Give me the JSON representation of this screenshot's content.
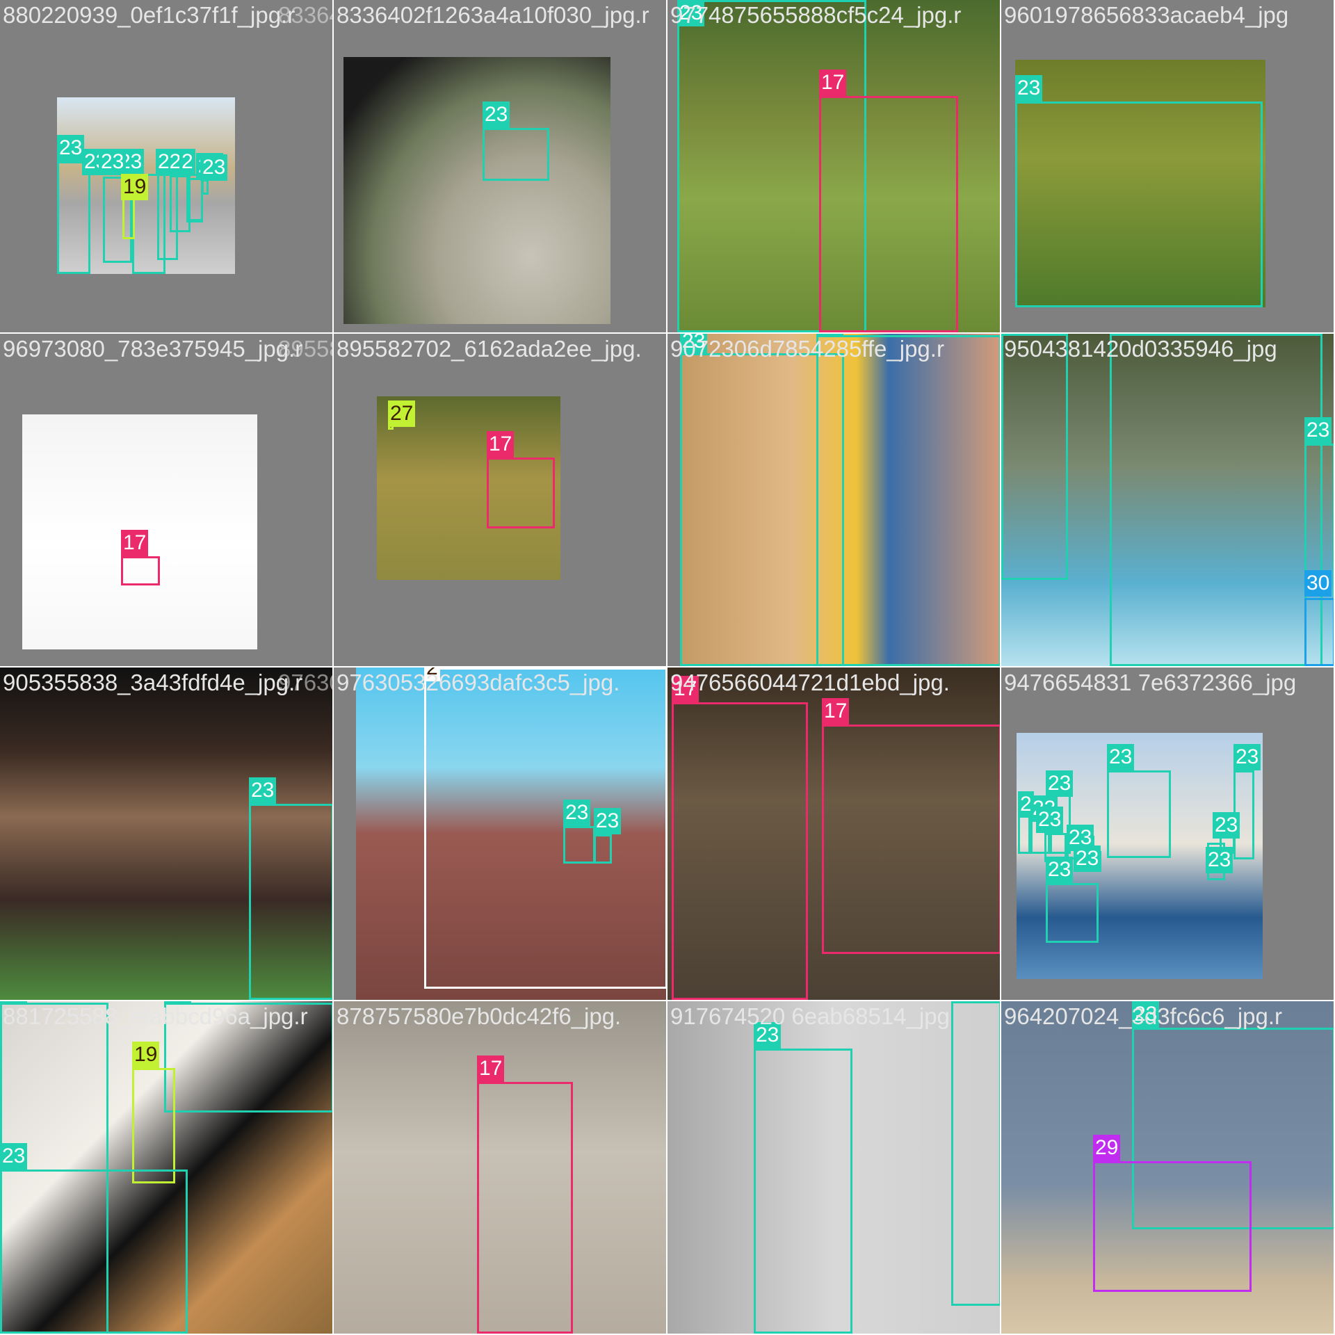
{
  "colors": {
    "23": "#1fd1b0",
    "17": "#ea2a6b",
    "19": "#c2f032",
    "27": "#c2f032",
    "29": "#c02cf0",
    "30": "#1ca1e8",
    "2": "#ffffff"
  },
  "tiles": [
    {
      "names": [
        "880220939_0ef1c37f1f_jpg.r",
        "8336402f1263a4a10f030_jpg."
      ],
      "boxes": [
        {
          "label": "23"
        },
        {
          "label": "23"
        },
        {
          "label": "23"
        },
        {
          "label": "23"
        },
        {
          "label": "22"
        },
        {
          "label": "23"
        },
        {
          "label": "19"
        },
        {
          "label": "2"
        },
        {
          "label": "23"
        }
      ]
    },
    {
      "names": [
        "8336402f1263a4a10f030_jpg.r"
      ],
      "boxes": [
        {
          "label": "23"
        }
      ]
    },
    {
      "names": [
        "9774875655888cf5c24_jpg.r"
      ],
      "boxes": [
        {
          "label": "23"
        },
        {
          "label": "17"
        }
      ]
    },
    {
      "names": [
        "9601978656833acaeb4_jpg"
      ],
      "boxes": [
        {
          "label": "23"
        }
      ]
    },
    {
      "names": [
        "96973080_783e375945_jpg.r",
        "895582702_6162ada2ee_jpg."
      ],
      "boxes": [
        {
          "label": "17"
        }
      ]
    },
    {
      "names": [
        "895582702_6162ada2ee_jpg."
      ],
      "boxes": [
        {
          "label": "27"
        },
        {
          "label": "17"
        }
      ]
    },
    {
      "names": [
        "9072306d7854285ffe_jpg.r"
      ],
      "boxes": [
        {
          "label": "23"
        },
        {
          "label": "23"
        }
      ]
    },
    {
      "names": [
        "9504381420d0335946_jpg"
      ],
      "boxes": [
        {
          "label": "23"
        },
        {
          "label": "23"
        },
        {
          "label": "23"
        },
        {
          "label": "30"
        }
      ]
    },
    {
      "names": [
        "905355838_3a43fdfd4e_jpg.r",
        "976305326693dafc3c5_jpg."
      ],
      "boxes": [
        {
          "label": "23"
        }
      ]
    },
    {
      "names": [
        "976305326693dafc3c5_jpg."
      ],
      "boxes": [
        {
          "label": "2"
        },
        {
          "label": "23"
        },
        {
          "label": "23"
        }
      ]
    },
    {
      "names": [
        "9476566044721d1ebd_jpg."
      ],
      "boxes": [
        {
          "label": "17"
        },
        {
          "label": "17"
        }
      ]
    },
    {
      "names": [
        "9476654831 7e6372366_jpg"
      ],
      "boxes": [
        {
          "label": "2"
        },
        {
          "label": "23"
        },
        {
          "label": "23"
        },
        {
          "label": "23"
        },
        {
          "label": "23"
        },
        {
          "label": "23"
        },
        {
          "label": "23"
        },
        {
          "label": "23"
        },
        {
          "label": "23"
        },
        {
          "label": "23"
        },
        {
          "label": "23"
        }
      ]
    },
    {
      "names": [
        "881725588_efabbcd96a_jpg.r"
      ],
      "boxes": [
        {
          "label": "23"
        },
        {
          "label": "23"
        },
        {
          "label": "19"
        },
        {
          "label": "23"
        }
      ]
    },
    {
      "names": [
        "878757580e7b0dc42f6_jpg."
      ],
      "boxes": [
        {
          "label": "17"
        }
      ]
    },
    {
      "names": [
        "917674520 6eab68514_jpg"
      ],
      "boxes": [
        {
          "label": "23"
        },
        {
          "label": "23"
        }
      ]
    },
    {
      "names": [
        "964207024_3d3fc6c6_jpg.r"
      ],
      "boxes": [
        {
          "label": "23"
        },
        {
          "label": "29"
        }
      ]
    }
  ]
}
